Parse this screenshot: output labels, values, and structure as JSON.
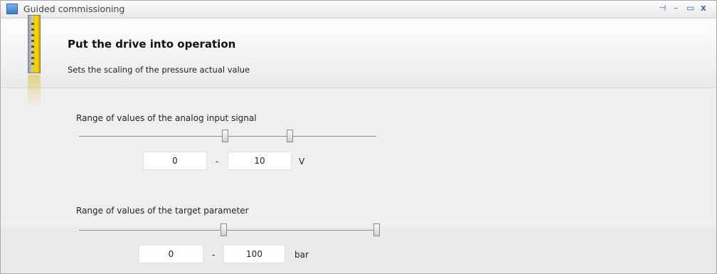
{
  "window": {
    "title": "Guided commissioning",
    "icon": "search-window-icon",
    "controls": {
      "pin": "⊣",
      "minimize": "–",
      "maximize": "▭",
      "close": "x"
    }
  },
  "header": {
    "title": "Put the drive into operation",
    "subtitle": "Sets the scaling of the pressure actual value",
    "image": "drive-icon"
  },
  "analog_input": {
    "label": "Range of values of the analog input signal",
    "min_value": "0",
    "separator": "-",
    "max_value": "10",
    "unit": "V"
  },
  "target_parameter": {
    "label": "Range of values of the target parameter",
    "min_value": "0",
    "separator": "-",
    "max_value": "100",
    "unit": "bar"
  }
}
